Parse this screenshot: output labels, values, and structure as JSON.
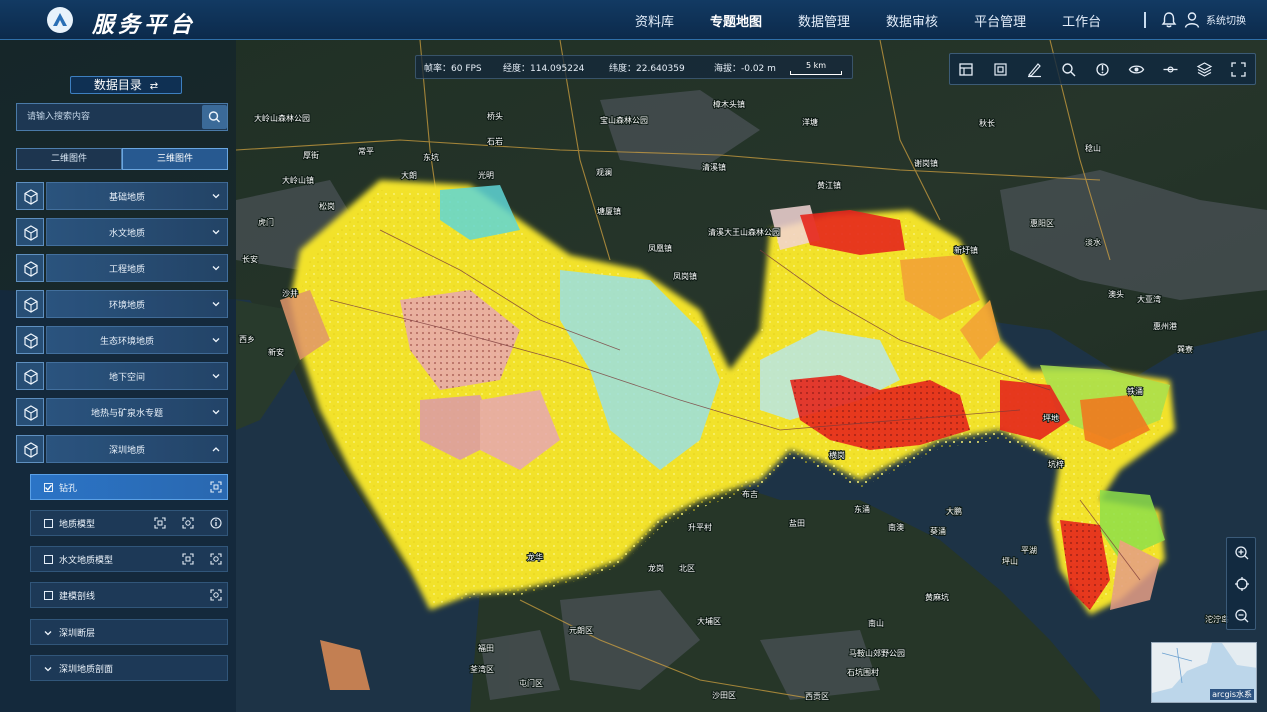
{
  "app": {
    "title": "服务平台"
  },
  "nav": {
    "items": [
      {
        "label": "资料库",
        "active": false
      },
      {
        "label": "专题地图",
        "active": true
      },
      {
        "label": "数据管理",
        "active": false
      },
      {
        "label": "数据审核",
        "active": false
      },
      {
        "label": "平台管理",
        "active": false
      },
      {
        "label": "工作台",
        "active": false
      }
    ],
    "system_switch": "系统切换"
  },
  "status": {
    "fps": "帧率：60 FPS",
    "lng": "经度：114.095224",
    "lat": "纬度：22.640359",
    "alt": "海拔：-0.02 m",
    "scale": "5 km"
  },
  "toolbar": {
    "tools": [
      "table-icon",
      "fullextent-icon",
      "measure-icon",
      "search-map-icon",
      "location-icon",
      "visibility-icon",
      "slice-icon",
      "layers-icon",
      "fullscreen-icon"
    ]
  },
  "panel": {
    "title": "数据目录",
    "title_arrow": "⇄",
    "search_placeholder": "请输入搜索内容",
    "tabs": [
      {
        "label": "二维图件",
        "active": false
      },
      {
        "label": "三维图件",
        "active": true
      }
    ],
    "categories": [
      {
        "label": "基础地质",
        "expanded": false
      },
      {
        "label": "水文地质",
        "expanded": false
      },
      {
        "label": "工程地质",
        "expanded": false
      },
      {
        "label": "环境地质",
        "expanded": false
      },
      {
        "label": "生态环境地质",
        "expanded": false
      },
      {
        "label": "地下空间",
        "expanded": false
      },
      {
        "label": "地热与矿泉水专题",
        "expanded": false
      },
      {
        "label": "深圳地质",
        "expanded": true
      }
    ],
    "sub_items": [
      {
        "label": "钻孔",
        "checked": true,
        "selected": true
      },
      {
        "label": "地质模型",
        "checked": false,
        "selected": false
      },
      {
        "label": "水文地质模型",
        "checked": false,
        "selected": false
      },
      {
        "label": "建模剖线",
        "checked": false,
        "selected": false
      },
      {
        "label": "深圳断层",
        "checked": false,
        "selected": false
      },
      {
        "label": "深圳地质剖面",
        "checked": false,
        "selected": false
      }
    ]
  },
  "map": {
    "labels": [
      "凤凰镇",
      "清溪镇",
      "塘厦镇",
      "凤岗镇",
      "清溪大王山森林公园",
      "宝山森林公园",
      "大岭山森林公园",
      "大岭山镇",
      "黄江镇",
      "樟木头镇",
      "谢岗镇",
      "惠阳区",
      "新圩镇",
      "秋长",
      "淡水",
      "东涌",
      "南澳",
      "葵涌",
      "大鹏",
      "升平村",
      "龙岗",
      "坪山",
      "盐田",
      "南山",
      "福田",
      "龙华",
      "沙井",
      "平湖",
      "大亚湾",
      "澳头",
      "虎门",
      "厚街",
      "长安",
      "大朗",
      "东坑",
      "常平",
      "桥头",
      "洋塘",
      "新安",
      "西乡",
      "松岗",
      "石岩",
      "光明",
      "观澜",
      "布吉",
      "横岗",
      "坪地",
      "坑梓",
      "惠州港",
      "铁涌",
      "稔山",
      "巽寮",
      "马鞍山郊野公园",
      "石坑围村",
      "西贡区",
      "北区",
      "元朗区",
      "屯门区",
      "荃湾区",
      "沙田区",
      "大埔区",
      "黄麻坑",
      "沱泞岛"
    ],
    "minimap_label": "arcgis水系"
  },
  "colors": {
    "accent": "#2b74c6",
    "topbar": "#0c2a4b",
    "panel_item": "#2c5682",
    "heat_yellow": "#f2e22a",
    "heat_red": "#e5261c",
    "sea": "#1e3448"
  }
}
